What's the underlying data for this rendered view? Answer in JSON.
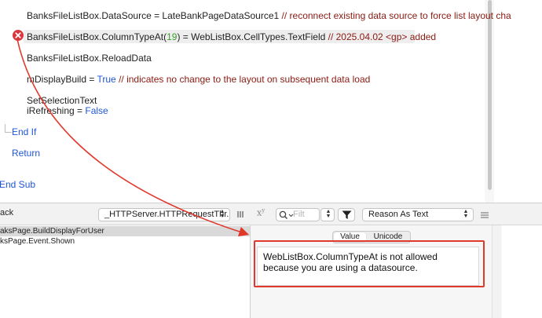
{
  "editor": {
    "lines": [
      {
        "id": "l1",
        "parts": [
          {
            "t": "BanksFileListBox.DataSource = LateBankPageDataSource1 ",
            "c": ""
          },
          {
            "t": "// reconnect existing data source to force list layout cha",
            "c": "cmt"
          }
        ]
      },
      {
        "id": "l2",
        "parts": [
          {
            "t": "BanksFileListBox.ColumnTypeAt(",
            "c": ""
          },
          {
            "t": "19",
            "c": "num"
          },
          {
            "t": ") = WebListBox.CellTypes.TextField ",
            "c": ""
          },
          {
            "t": "// 2025.04.02 <gp> added",
            "c": "cmt"
          }
        ]
      },
      {
        "id": "l3",
        "parts": [
          {
            "t": "BanksFileListBox.ReloadData",
            "c": ""
          }
        ]
      },
      {
        "id": "l4",
        "parts": [
          {
            "t": "mDisplayBuild = ",
            "c": ""
          },
          {
            "t": "True",
            "c": "kw"
          },
          {
            "t": " ",
            "c": ""
          },
          {
            "t": "// indicates no change to the layout on subsequent data load",
            "c": "cmt"
          }
        ]
      },
      {
        "id": "l5",
        "parts": [
          {
            "t": "SetSelectionText",
            "c": ""
          }
        ]
      },
      {
        "id": "l6",
        "parts": [
          {
            "t": "iRefreshing = ",
            "c": ""
          },
          {
            "t": "False",
            "c": "kw"
          }
        ]
      },
      {
        "id": "l7",
        "parts": [
          {
            "t": "End If",
            "c": "kw"
          }
        ]
      },
      {
        "id": "l8",
        "parts": [
          {
            "t": "Return",
            "c": "kw"
          }
        ]
      },
      {
        "id": "l9",
        "parts": [
          {
            "t": "End Sub",
            "c": "kw"
          }
        ]
      }
    ]
  },
  "toolbar": {
    "stack_label": "ack",
    "thread_popup": "_HTTPServer.HTTPRequestThr...",
    "filter_placeholder": "Filt",
    "format_popup": "Reason As Text"
  },
  "stack": {
    "rows": [
      "aksPage.BuildDisplayForUser",
      "ksPage.Event.Shown"
    ]
  },
  "variables": {
    "tabs": {
      "value": "Value",
      "unicode": "Unicode"
    },
    "message": "WebListBox.ColumnTypeAt is not allowed because you are using a datasource."
  },
  "colors": {
    "error": "#d9363e",
    "annotation": "#e0382b",
    "keyword": "#1f55d6",
    "comment": "#8b1a12",
    "number": "#3a9d2a"
  },
  "icons": [
    "error-icon",
    "list-icon",
    "superscript-xy-icon",
    "search-icon",
    "chevron-down-icon",
    "filter-icon",
    "menu-icon",
    "updown-arrows-icon"
  ]
}
